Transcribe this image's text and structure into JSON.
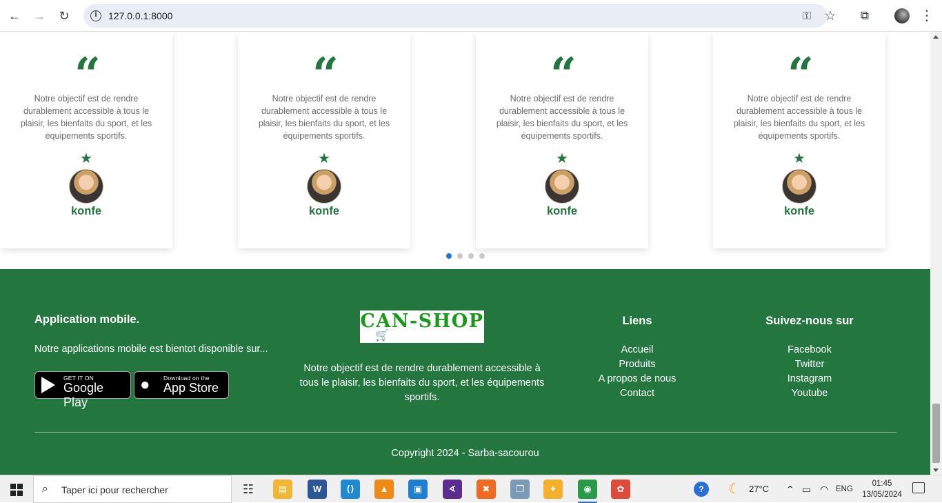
{
  "browser": {
    "url": "127.0.0.1:8000",
    "back_icon": "←",
    "forward_icon": "→",
    "reload_icon": "↻",
    "info_icon": "i",
    "key_icon": "⚿",
    "star_icon": "☆",
    "extensions_icon": "⧉",
    "menu_icon": "⋮"
  },
  "testimonials": {
    "cards": [
      {
        "quote": "“",
        "text": "Notre objectif est de rendre durablement accessible à tous le plaisir, les bienfaits du sport, et les équipements sportifs.",
        "star": "★",
        "name": "konfe"
      },
      {
        "quote": "“",
        "text": "Notre objectif est de rendre durablement accessible à tous le plaisir, les bienfaits du sport, et les équipements sportifs.",
        "star": "★",
        "name": "konfe"
      },
      {
        "quote": "“",
        "text": "Notre objectif est de rendre durablement accessible à tous le plaisir, les bienfaits du sport, et les équipements sportifs.",
        "star": "★",
        "name": "konfe"
      },
      {
        "quote": "“",
        "text": "Notre objectif est de rendre durablement accessible à tous le plaisir, les bienfaits du sport, et les équipements sportifs.",
        "star": "★",
        "name": "konfe"
      }
    ],
    "dots_count": 4,
    "active_dot": 0
  },
  "footer": {
    "mobile": {
      "title": "Application mobile.",
      "text": "Notre applications mobile est bientot disponible sur...",
      "google_play": {
        "small": "GET IT ON",
        "big": "Google Play"
      },
      "app_store": {
        "small": "Download on the",
        "big": "App Store",
        "logo": ""
      }
    },
    "brand": {
      "name": "CAN-SHOP",
      "cart_icon": "🛒",
      "description": "Notre objectif est de rendre durablement accessible à tous le plaisir, les bienfaits du sport, et les équipements sportifs."
    },
    "links": {
      "title": "Liens",
      "items": [
        "Accueil",
        "Produits",
        "A propos de nous",
        "Contact"
      ]
    },
    "social": {
      "title": "Suivez-nous sur",
      "items": [
        "Facebook",
        "Twitter",
        "Instagram",
        "Youtube"
      ]
    },
    "copyright": "Copyright 2024 - Sarba-sacourou"
  },
  "taskbar": {
    "search_placeholder": "Taper ici pour rechercher",
    "search_icon": "⌕",
    "apps": [
      {
        "name": "task-view",
        "label": "☷",
        "color": "#f0f0f0"
      },
      {
        "name": "file-explorer",
        "label": "▤",
        "color": "#f2b632"
      },
      {
        "name": "word",
        "label": "W",
        "color": "#2b5797"
      },
      {
        "name": "vscode",
        "label": "⟨⟩",
        "color": "#1f8ad2"
      },
      {
        "name": "vlc",
        "label": "▲",
        "color": "#f08a14"
      },
      {
        "name": "virtualbox",
        "label": "▣",
        "color": "#1d7fd0"
      },
      {
        "name": "visual-studio",
        "label": "∢",
        "color": "#5c2d91"
      },
      {
        "name": "xampp",
        "label": "✖",
        "color": "#f06a20"
      },
      {
        "name": "image-viewer",
        "label": "❐",
        "color": "#7a9ab8"
      },
      {
        "name": "app-yellow",
        "label": "✦",
        "color": "#f4b02a"
      },
      {
        "name": "chrome",
        "label": "◉",
        "color": "#2a9a4a"
      },
      {
        "name": "paint",
        "label": "✿",
        "color": "#e04a3a"
      }
    ],
    "help_icon": "?",
    "weather": "27°C",
    "weather_icon": "☾",
    "tray_icons": [
      "⌃",
      "▭",
      "◠",
      "≡"
    ],
    "language": "ENG",
    "time": "01:45",
    "date": "13/05/2024"
  }
}
